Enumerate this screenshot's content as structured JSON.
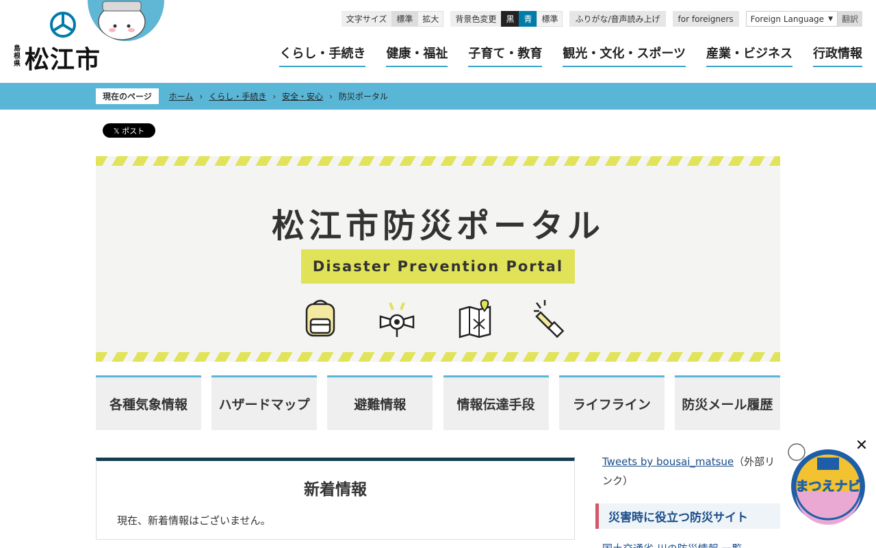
{
  "header": {
    "pref_label": "島根県",
    "city_name": "松江市",
    "toolbar": {
      "font_size_label": "文字サイズ",
      "font_standard": "標準",
      "font_large": "拡大",
      "bg_label": "背景色変更",
      "bg_black": "黒",
      "bg_blue": "青",
      "bg_standard": "標準",
      "furigana": "ふりがな/音声読み上げ",
      "foreigners": "for foreigners",
      "language_select": "Foreign Language",
      "translate": "翻訳"
    },
    "nav": [
      "くらし・手続き",
      "健康・福祉",
      "子育て・教育",
      "観光・文化・スポーツ",
      "産業・ビジネス",
      "行政情報"
    ]
  },
  "breadcrumb": {
    "label": "現在のページ",
    "links": [
      "ホーム",
      "くらし・手続き",
      "安全・安心"
    ],
    "current": "防災ポータル",
    "separator": "›"
  },
  "social": {
    "x_post": "𝕏 ポスト"
  },
  "hero": {
    "title": "松江市防災ポータル",
    "subtitle": "Disaster Prevention Portal",
    "icons": [
      "backpack-icon",
      "siren-icon",
      "map-icon",
      "flashlight-icon"
    ]
  },
  "tiles": [
    "各種気象情報",
    "ハザードマップ",
    "避難情報",
    "情報伝達手段",
    "ライフライン",
    "防災メール履歴"
  ],
  "news": {
    "heading": "新着情報",
    "body": "現在、新着情報はございません。"
  },
  "sidebar": {
    "tweets_link": "Tweets by bousai_matsue",
    "tweets_note": "（外部リンク）",
    "section_heading": "災害時に役立つ防災サイト",
    "next_link": "国土交通省 川の防災情報 一覧"
  },
  "navi": {
    "label": "まつえナビ",
    "close": "✕"
  },
  "colors": {
    "accent_blue": "#5ab6d6",
    "hero_yellow": "#e0e258",
    "news_border": "#173e4e",
    "side_accent": "#d6566a"
  }
}
